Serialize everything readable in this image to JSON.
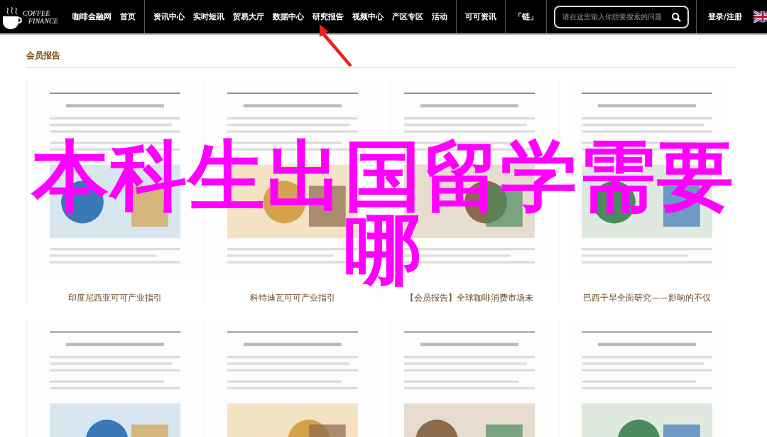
{
  "logo": {
    "line1": "COFFEE",
    "line2": "FINANCE"
  },
  "nav_groups": [
    {
      "links": [
        "咖啡金融网",
        "首页"
      ]
    },
    {
      "links": [
        "资讯中心",
        "实时短讯",
        "贸易大厅",
        "数据中心",
        "研究报告",
        "视频中心",
        "产区专区",
        "活动"
      ]
    },
    {
      "links": [
        "可可资讯"
      ]
    },
    {
      "links": [
        "「链」"
      ]
    }
  ],
  "search": {
    "placeholder": "请在这里输入你想要搜索的问题"
  },
  "login": "登录/注册",
  "section": {
    "title": "会员报告"
  },
  "reports": [
    {
      "caption": "印度尼西亚可可产业指引",
      "kind": "picture"
    },
    {
      "caption": "科特迪瓦可可产业指引",
      "kind": "picture"
    },
    {
      "caption": "【会员报告】全球咖啡消费市场未",
      "kind": "picture"
    },
    {
      "caption": "巴西干旱全面研究——影响的不仅",
      "kind": "picture"
    },
    {
      "kind": "picture"
    },
    {
      "kind": "picture"
    },
    {
      "kind": "picture"
    },
    {
      "kind": "picture"
    }
  ],
  "overlay": {
    "lines": [
      "本科生出国留学需要",
      "哪"
    ]
  }
}
